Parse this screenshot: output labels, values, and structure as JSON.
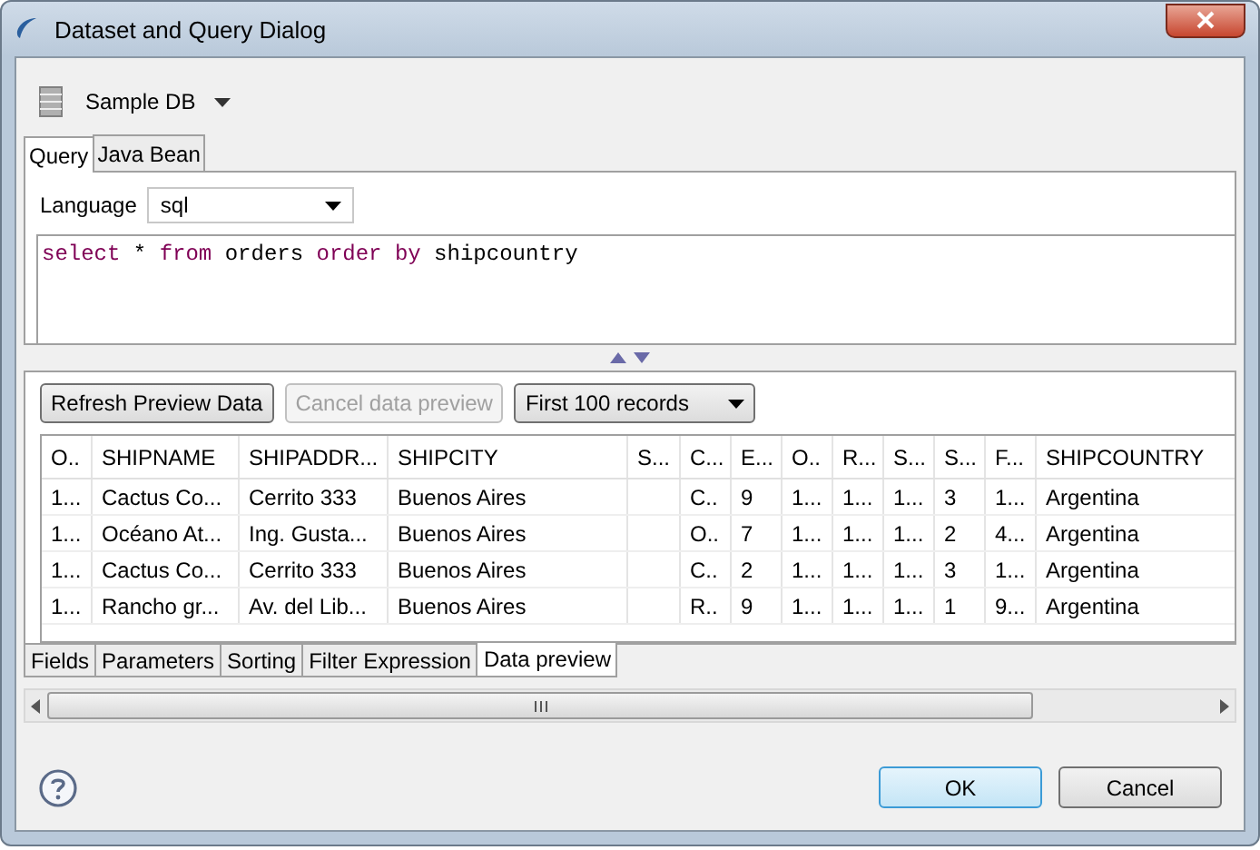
{
  "window": {
    "title": "Dataset and Query Dialog"
  },
  "data_source": {
    "label": "Sample DB"
  },
  "query_tabs": [
    {
      "label": "Query",
      "selected": true
    },
    {
      "label": "Java Bean",
      "selected": false
    }
  ],
  "language": {
    "label": "Language",
    "value": "sql"
  },
  "query": {
    "tokens": [
      {
        "text": "select",
        "kind": "keyword"
      },
      {
        "text": " * ",
        "kind": "plain"
      },
      {
        "text": "from",
        "kind": "keyword"
      },
      {
        "text": " orders ",
        "kind": "plain"
      },
      {
        "text": "order by",
        "kind": "keyword"
      },
      {
        "text": " shipcountry",
        "kind": "plain"
      }
    ]
  },
  "preview_toolbar": {
    "refresh": {
      "label": "Refresh Preview Data",
      "disabled": false
    },
    "cancel": {
      "label": "Cancel data preview",
      "disabled": true
    },
    "limit": {
      "value": "First 100 records"
    }
  },
  "table": {
    "columns": [
      "O..",
      "SHIPNAME",
      "SHIPADDR...",
      "SHIPCITY",
      "S...",
      "C...",
      "E...",
      "O..",
      "R...",
      "S...",
      "S...",
      "F...",
      "SHIPCOUNTRY"
    ],
    "rows": [
      [
        "1...",
        "Cactus Co...",
        "Cerrito 333",
        "Buenos Aires",
        null,
        "C..",
        "9",
        "1...",
        "1...",
        "1...",
        "3",
        "1...",
        "Argentina"
      ],
      [
        "1...",
        "Océano At...",
        "Ing. Gusta...",
        "Buenos Aires",
        null,
        "O..",
        "7",
        "1...",
        "1...",
        "1...",
        "2",
        "4...",
        "Argentina"
      ],
      [
        "1...",
        "Cactus Co...",
        "Cerrito 333",
        "Buenos Aires",
        null,
        "C..",
        "2",
        "1...",
        "1...",
        "1...",
        "3",
        "1...",
        "Argentina"
      ],
      [
        "1...",
        "Rancho gr...",
        "Av. del Lib...",
        "Buenos Aires",
        null,
        "R..",
        "9",
        "1...",
        "1...",
        "1...",
        "1",
        "9...",
        "Argentina"
      ]
    ]
  },
  "bottom_tabs": [
    {
      "label": "Fields",
      "selected": false
    },
    {
      "label": "Parameters",
      "selected": false
    },
    {
      "label": "Sorting",
      "selected": false
    },
    {
      "label": "Filter Expression",
      "selected": false
    },
    {
      "label": "Data preview",
      "selected": true
    }
  ],
  "buttons": [
    {
      "label": "OK",
      "kind": "default"
    },
    {
      "label": "Cancel",
      "kind": "normal"
    }
  ]
}
